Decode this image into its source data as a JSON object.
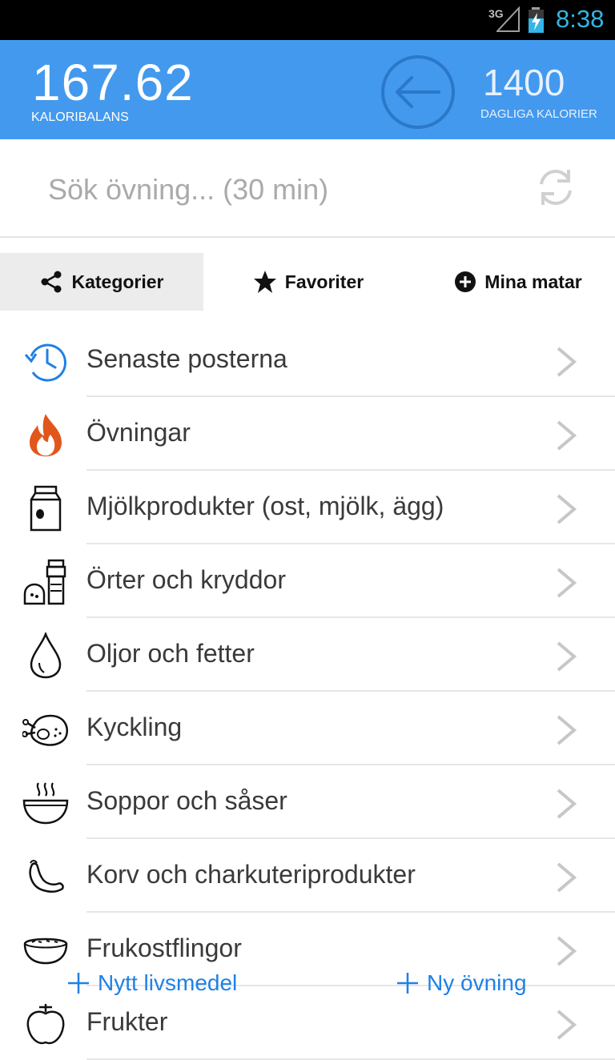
{
  "status": {
    "network": "3G",
    "time": "8:38"
  },
  "header": {
    "balance": "167.62",
    "balance_label": "KALORIBALANS",
    "daily": "1400",
    "daily_label": "DAGLIGA KALORIER",
    "accent": "#4399ee"
  },
  "search": {
    "placeholder": "Sök övning... (30 min)"
  },
  "tabs": [
    {
      "label": "Kategorier",
      "icon": "share-icon",
      "active": true
    },
    {
      "label": "Favoriter",
      "icon": "star-icon",
      "active": false
    },
    {
      "label": "Mina matar",
      "icon": "plus-circle-icon",
      "active": false
    }
  ],
  "categories": [
    {
      "label": "Senaste posterna",
      "icon": "history-clock-icon"
    },
    {
      "label": "Övningar",
      "icon": "flame-icon"
    },
    {
      "label": "Mjölkprodukter (ost, mjölk, ägg)",
      "icon": "milk-carton-icon"
    },
    {
      "label": "Örter och kryddor",
      "icon": "spice-shaker-icon"
    },
    {
      "label": "Oljor och fetter",
      "icon": "oil-drop-icon"
    },
    {
      "label": "Kyckling",
      "icon": "roast-chicken-icon"
    },
    {
      "label": "Soppor och såser",
      "icon": "soup-bowl-icon"
    },
    {
      "label": "Korv och charkuteriprodukter",
      "icon": "sausage-icon"
    },
    {
      "label": "Frukostflingor",
      "icon": "cereal-bowl-icon"
    },
    {
      "label": "Frukter",
      "icon": "apple-icon"
    }
  ],
  "actions": {
    "new_food": "Nytt livsmedel",
    "new_exercise": "Ny övning"
  }
}
